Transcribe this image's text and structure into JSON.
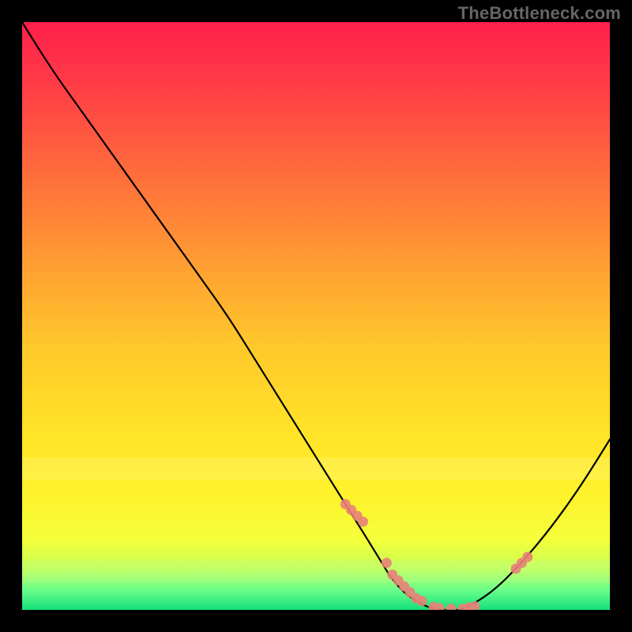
{
  "watermark": "TheBottleneck.com",
  "chart_data": {
    "type": "line",
    "title": "",
    "xlabel": "",
    "ylabel": "",
    "xlim": [
      0,
      100
    ],
    "ylim": [
      0,
      100
    ],
    "series": [
      {
        "name": "bottleneck-curve",
        "x": [
          0,
          5,
          10,
          15,
          20,
          25,
          30,
          35,
          40,
          45,
          50,
          55,
          60,
          63,
          66,
          70,
          73,
          75,
          80,
          85,
          90,
          95,
          100
        ],
        "y": [
          100,
          92,
          85,
          78,
          71,
          64,
          57,
          50,
          42,
          34,
          26,
          18,
          10,
          5,
          2,
          0,
          0,
          0,
          3,
          8,
          14,
          21,
          29
        ]
      }
    ],
    "scatter": [
      {
        "name": "highlight-points",
        "x": [
          55,
          56,
          57,
          58,
          62,
          63,
          64,
          65,
          66,
          67,
          68,
          70,
          71,
          73,
          75,
          76,
          77,
          84,
          85,
          86
        ],
        "y": [
          18,
          17,
          16,
          15,
          8,
          6,
          5,
          4,
          3,
          2,
          1.5,
          0.5,
          0.3,
          0.2,
          0.2,
          0.4,
          0.6,
          7,
          8,
          9
        ]
      }
    ],
    "gradient_stops": [
      {
        "offset": 0.0,
        "color": "#ff1f4b"
      },
      {
        "offset": 0.1,
        "color": "#ff3a46"
      },
      {
        "offset": 0.25,
        "color": "#ff6a3c"
      },
      {
        "offset": 0.4,
        "color": "#ff9a33"
      },
      {
        "offset": 0.55,
        "color": "#ffc82b"
      },
      {
        "offset": 0.7,
        "color": "#ffe327"
      },
      {
        "offset": 0.8,
        "color": "#fff22b"
      },
      {
        "offset": 0.88,
        "color": "#f4ff3a"
      },
      {
        "offset": 0.93,
        "color": "#c8ff55"
      },
      {
        "offset": 0.965,
        "color": "#6cff8a"
      },
      {
        "offset": 1.0,
        "color": "#14e07a"
      }
    ],
    "glow_bands": [
      {
        "y": 0.76,
        "color": "rgba(255,255,200,0.18)"
      },
      {
        "y": 0.935,
        "color": "rgba(180,255,170,0.22)"
      }
    ]
  }
}
